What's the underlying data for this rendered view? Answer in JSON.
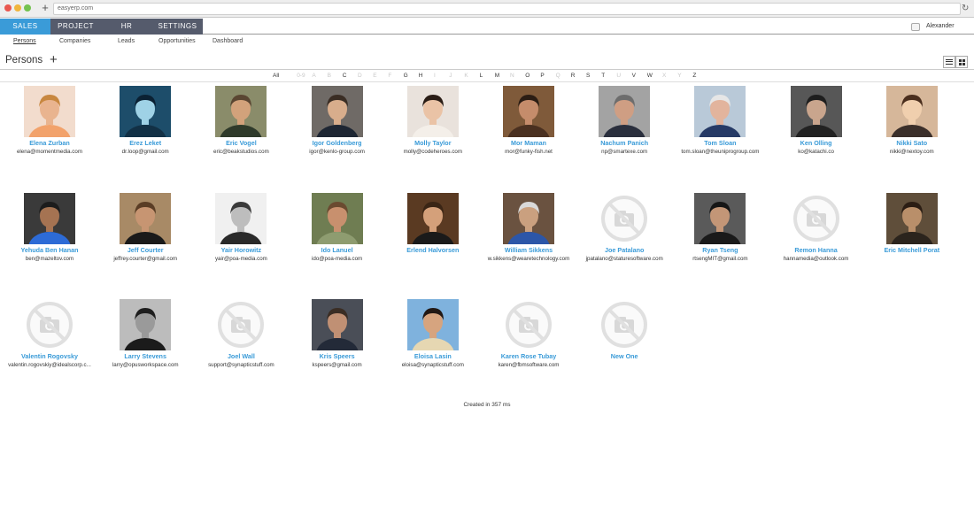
{
  "browser": {
    "url": "easyerp.com",
    "new_tab_label": "+",
    "reload_label": "↻"
  },
  "topnav": {
    "sales": "SALES",
    "project": "PROJECT",
    "hr": "HR",
    "settings": "SETTINGS",
    "user": "Alexander"
  },
  "subnav": [
    "Persons",
    "Companies",
    "Leads",
    "Opportunities",
    "Dashboard"
  ],
  "page": {
    "title": "Persons",
    "add_label": "+"
  },
  "alphabet": [
    {
      "l": "All",
      "on": true
    },
    {
      "l": "0-9",
      "on": false
    },
    {
      "l": "A",
      "on": false
    },
    {
      "l": "B",
      "on": false
    },
    {
      "l": "C",
      "on": true
    },
    {
      "l": "D",
      "on": false
    },
    {
      "l": "E",
      "on": false
    },
    {
      "l": "F",
      "on": false
    },
    {
      "l": "G",
      "on": true
    },
    {
      "l": "H",
      "on": true
    },
    {
      "l": "I",
      "on": false
    },
    {
      "l": "J",
      "on": false
    },
    {
      "l": "K",
      "on": false
    },
    {
      "l": "L",
      "on": true
    },
    {
      "l": "M",
      "on": true
    },
    {
      "l": "N",
      "on": false
    },
    {
      "l": "O",
      "on": true
    },
    {
      "l": "P",
      "on": true
    },
    {
      "l": "Q",
      "on": false
    },
    {
      "l": "R",
      "on": true
    },
    {
      "l": "S",
      "on": true
    },
    {
      "l": "T",
      "on": true
    },
    {
      "l": "U",
      "on": false
    },
    {
      "l": "V",
      "on": true
    },
    {
      "l": "W",
      "on": true
    },
    {
      "l": "X",
      "on": false
    },
    {
      "l": "Y",
      "on": false
    },
    {
      "l": "Z",
      "on": true
    }
  ],
  "persons": [
    {
      "name": "Elena Zurban",
      "email": "elena@momentmedia.com",
      "photo": true,
      "skin": "#e9b48f",
      "hair": "#c8873f",
      "bg": "#f2dccd",
      "shirt": "#f2a26b"
    },
    {
      "name": "Erez Leket",
      "email": "dr.loop@gmail.com",
      "photo": true,
      "skin": "#9fd2e6",
      "hair": "#0b2133",
      "bg": "#1d4d6a",
      "shirt": "#123045"
    },
    {
      "name": "Eric Vogel",
      "email": "eric@beakstudios.com",
      "photo": true,
      "skin": "#d2a27b",
      "hair": "#5a4632",
      "bg": "#8a8c6a",
      "shirt": "#2f3a2a"
    },
    {
      "name": "Igor Goldenberg",
      "email": "igor@kenlo-group.com",
      "photo": true,
      "skin": "#d8ad8c",
      "hair": "#3a2d24",
      "bg": "#6f6a66",
      "shirt": "#1e2633"
    },
    {
      "name": "Molly Taylor",
      "email": "molly@codeheroes.com",
      "photo": true,
      "skin": "#eac3a6",
      "hair": "#2a1d16",
      "bg": "#e9e2dc",
      "shirt": "#f4efe9"
    },
    {
      "name": "Mor Maman",
      "email": "mor@funky-fish.net",
      "photo": true,
      "skin": "#c58c6b",
      "hair": "#2b1d14",
      "bg": "#7f5a3a",
      "shirt": "#4a3020"
    },
    {
      "name": "Nachum Panich",
      "email": "np@smartexe.com",
      "photo": true,
      "skin": "#cf9e83",
      "hair": "#6d6d6d",
      "bg": "#a3a3a3",
      "shirt": "#2a2f3d"
    },
    {
      "name": "Tom Sloan",
      "email": "tom.sloan@theuniprogroup.com",
      "photo": true,
      "skin": "#e2b49d",
      "hair": "#e6e6e6",
      "bg": "#b9c9d8",
      "shirt": "#263a66"
    },
    {
      "name": "Ken Olling",
      "email": "ko@katachi.co",
      "photo": true,
      "skin": "#c9a58d",
      "hair": "#1e1e1e",
      "bg": "#575757",
      "shirt": "#222"
    },
    {
      "name": "Nikki Sato",
      "email": "nikki@nextoy.com",
      "photo": true,
      "skin": "#f0cfae",
      "hair": "#4a2e1d",
      "bg": "#d6b79a",
      "shirt": "#3b2f2a"
    },
    {
      "name": "Yehuda Ben Hanan",
      "email": "ben@mazeltov.com",
      "photo": true,
      "skin": "#a57352",
      "hair": "#1c1c1c",
      "bg": "#3a3a3a",
      "shirt": "#2d6bd6"
    },
    {
      "name": "Jeff Courter",
      "email": "jeffrey.courter@gmail.com",
      "photo": true,
      "skin": "#c79572",
      "hair": "#5a3d25",
      "bg": "#a88a66",
      "shirt": "#1a1a1a"
    },
    {
      "name": "Yair Horowitz",
      "email": "yair@poa-media.com",
      "photo": true,
      "skin": "#bdbdbd",
      "hair": "#3a3a3a",
      "bg": "#f0f0f0",
      "shirt": "#2a2a2a"
    },
    {
      "name": "Ido Lanuel",
      "email": "ido@poa-media.com",
      "photo": true,
      "skin": "#c8906e",
      "hair": "#6a4a30",
      "bg": "#6f7d52",
      "shirt": "#8e9c70"
    },
    {
      "name": "Erlend Halvorsen",
      "email": "",
      "photo": true,
      "skin": "#d4a07a",
      "hair": "#3a2515",
      "bg": "#5a3a22",
      "shirt": "#1a1a1a"
    },
    {
      "name": "William Sikkens",
      "email": "w.sikkens@wearetechnology.com",
      "photo": true,
      "skin": "#caa07f",
      "hair": "#d9d9d9",
      "bg": "#6a5240",
      "shirt": "#2c56a8"
    },
    {
      "name": "Joe Patalano",
      "email": "jpatalano@staturesoftware.com",
      "photo": false
    },
    {
      "name": "Ryan Tseng",
      "email": "rtsengMIT@gmail.com",
      "photo": true,
      "skin": "#c39677",
      "hair": "#161616",
      "bg": "#5a5a5a",
      "shirt": "#1a1a1a"
    },
    {
      "name": "Remon Hanna",
      "email": "hannamedia@outlook.com",
      "photo": false
    },
    {
      "name": "Eric Mitchell Porat",
      "email": "",
      "photo": true,
      "skin": "#b98f6a",
      "hair": "#2b1d14",
      "bg": "#5f4e3a",
      "shirt": "#2b241d"
    },
    {
      "name": "Valentin Rogovsky",
      "email": "valentin.rogovskiy@idealscorp.c...",
      "photo": false
    },
    {
      "name": "Larry Stevens",
      "email": "larry@opusworkspace.com",
      "photo": true,
      "skin": "#9a9a9a",
      "hair": "#1e1e1e",
      "bg": "#bcbcbc",
      "shirt": "#1b1b1b"
    },
    {
      "name": "Joel Wall",
      "email": "support@synapticstuff.com",
      "photo": false
    },
    {
      "name": "Kris Speers",
      "email": "kspeers@gmail.com",
      "photo": true,
      "skin": "#c09074",
      "hair": "#3a2d24",
      "bg": "#4a4e57",
      "shirt": "#232a38"
    },
    {
      "name": "Eloisa Lasin",
      "email": "eloisa@synapticstuff.com",
      "photo": true,
      "skin": "#d6a47f",
      "hair": "#221814",
      "bg": "#7fb2dd",
      "shirt": "#e6d7b2"
    },
    {
      "name": "Karen Rose Tubay",
      "email": "karen@fbmsoftware.com",
      "photo": false
    },
    {
      "name": "New One",
      "email": "",
      "photo": false
    }
  ],
  "footer": {
    "text": "Created in 357 ms"
  },
  "colors": {
    "accent": "#3a9bd8",
    "nav_dark": "#555b6c"
  }
}
